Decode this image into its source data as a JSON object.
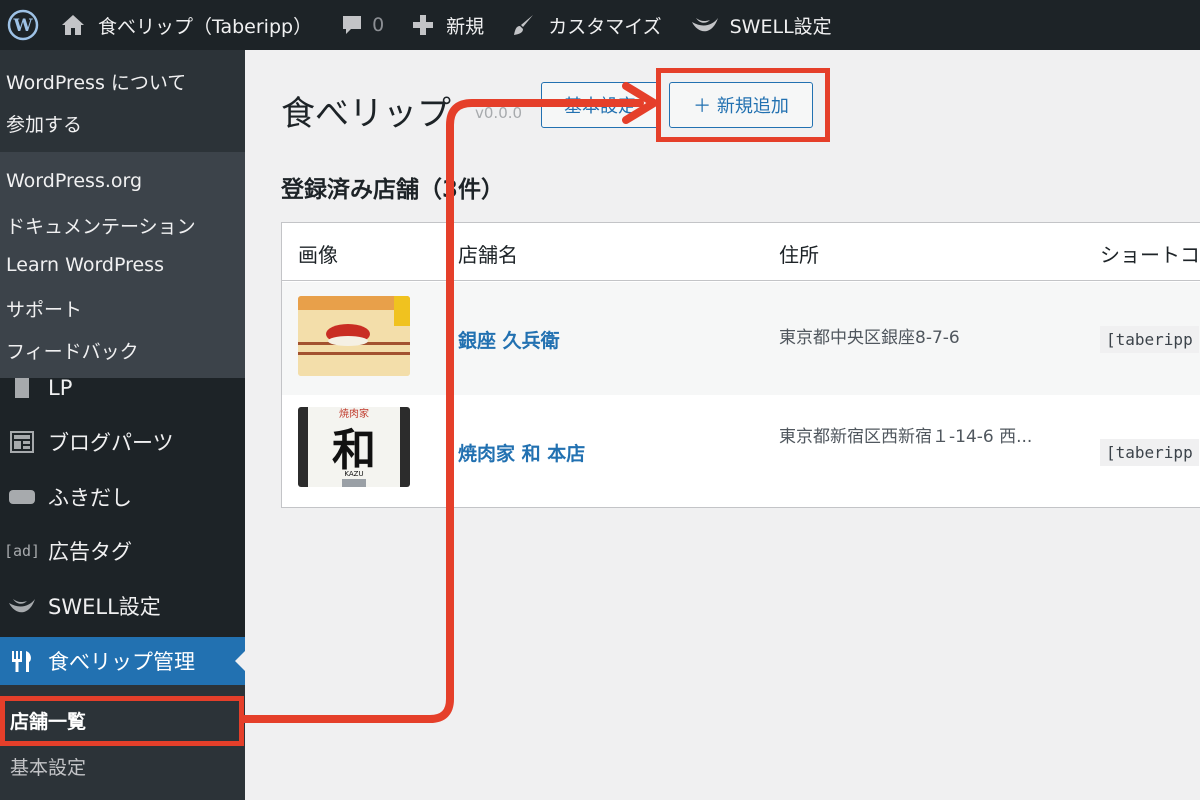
{
  "adminbar": {
    "site_name": "食べリップ（Taberipp）",
    "comments_count": "0",
    "new_label": "新規",
    "customize_label": "カスタマイズ",
    "swell_label": "SWELL設定"
  },
  "wp_menu": {
    "top_items": [
      "WordPress について",
      "参加する"
    ],
    "bottom_items": [
      "WordPress.org",
      "ドキュメンテーション",
      "Learn WordPress",
      "サポート",
      "フィードバック"
    ]
  },
  "sidebar": {
    "items": [
      {
        "label": "LP",
        "icon": "page-icon"
      },
      {
        "label": "ブログパーツ",
        "icon": "layout-icon"
      },
      {
        "label": "ふきだし",
        "icon": "speech-bubble-icon"
      },
      {
        "label": "広告タグ",
        "icon": "ad-icon",
        "icon_text": "[ad]"
      },
      {
        "label": "SWELL設定",
        "icon": "swell-icon"
      },
      {
        "label": "食べリップ管理",
        "icon": "utensils-icon"
      }
    ],
    "submenu": [
      "店舗一覧",
      "基本設定"
    ]
  },
  "main": {
    "title": "食べリップ",
    "version": "v0.0.0",
    "settings_button": "基本設定",
    "add_button": "＋ 新規追加",
    "section_title": "登録済み店舗（3件）",
    "columns": [
      "画像",
      "店舗名",
      "住所",
      "ショートコ"
    ],
    "rows": [
      {
        "name": "銀座 久兵衛",
        "address": "東京都中央区銀座8-7-6",
        "shortcode": "[taberipp"
      },
      {
        "name": "焼肉家 和 本店",
        "address": "東京都新宿区西新宿１-14-6 西...",
        "shortcode": "[taberipp"
      }
    ],
    "sign_text": "和",
    "sign_top": "焼肉家",
    "sign_small": "KAZU"
  },
  "colors": {
    "adminbar_bg": "#1d2327",
    "accent": "#2271b1",
    "annotation": "#e53f2a"
  }
}
